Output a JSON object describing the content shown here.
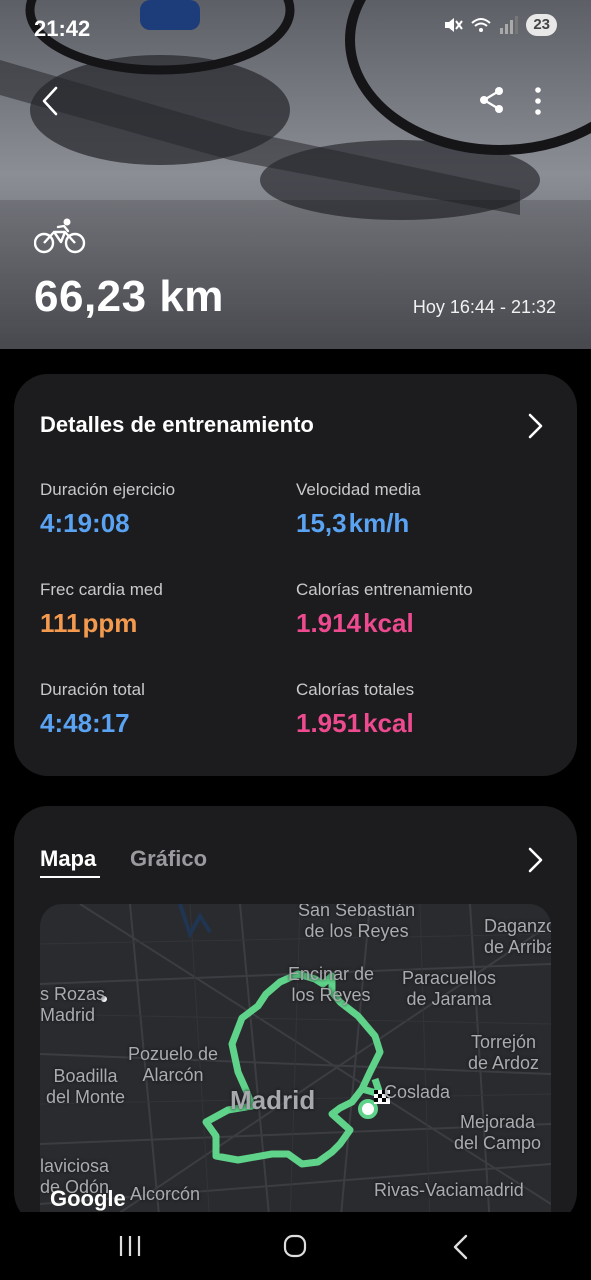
{
  "status_bar": {
    "time": "21:42",
    "battery": "23",
    "icons": [
      "mute-icon",
      "wifi-icon",
      "signal-icon"
    ]
  },
  "hero": {
    "activity_icon": "bike-icon",
    "distance": "66,23 km",
    "time_range": "Hoy 16:44 - 21:32"
  },
  "workout": {
    "title": "Detalles de entrenamiento",
    "stats": [
      {
        "label": "Duración ejercicio",
        "value": "4:19:08",
        "unit": "",
        "color": "#5aa3f2"
      },
      {
        "label": "Velocidad media",
        "value": "15,3",
        "unit": "km/h",
        "color": "#5aa3f2"
      },
      {
        "label": "Frec cardia med",
        "value": "111",
        "unit": "ppm",
        "color": "#f39a4f"
      },
      {
        "label": "Calorías entrenamiento",
        "value": "1.914",
        "unit": "kcal",
        "color": "#ee4a8f"
      },
      {
        "label": "Duración total",
        "value": "4:48:17",
        "unit": "",
        "color": "#5aa3f2"
      },
      {
        "label": "Calorías totales",
        "value": "1.951",
        "unit": "kcal",
        "color": "#ee4a8f"
      }
    ]
  },
  "map_card": {
    "tabs": [
      {
        "label": "Mapa",
        "active": true
      },
      {
        "label": "Gráfico",
        "active": false
      }
    ],
    "route_color": "#5fd38a",
    "places": {
      "san_sebastian": "San Sebastián\nde los Reyes",
      "daganzo": "Daganzo\nde Arriba",
      "encinar": "Encinar de\nlos Reyes",
      "paracuellos": "Paracuellos\nde Jarama",
      "las_rozas": "s Rozas\nMadrid",
      "torrejon": "Torrejón\nde Ardoz",
      "pozuelo": "Pozuelo de\nAlarcón",
      "boadilla": "Boadilla\ndel Monte",
      "coslada": "Coslada",
      "madrid": "Madrid",
      "mejorada": "Mejorada\ndel Campo",
      "villaviciosa": "laviciosa\nde Odón",
      "alcorcon": "Alcorcón",
      "rivas": "Rivas-Vaciamadrid"
    },
    "attribution": "Google"
  },
  "nav": {
    "recent": "recent-apps-icon",
    "home": "home-icon",
    "back": "back-icon"
  }
}
